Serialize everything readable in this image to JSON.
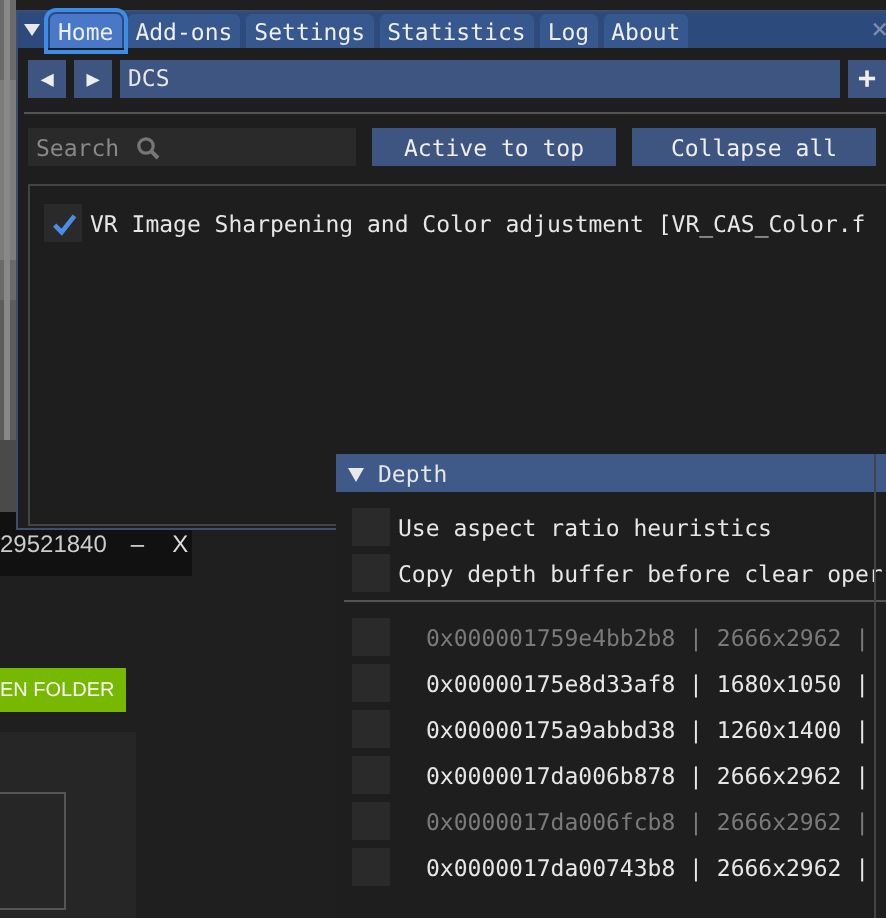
{
  "background_window": {
    "title": "29521840",
    "minimize": "–",
    "close": "X",
    "button": "EN FOLDER"
  },
  "main_window": {
    "tabs": [
      {
        "label": "Home",
        "selected": true
      },
      {
        "label": "Add-ons",
        "selected": false
      },
      {
        "label": "Settings",
        "selected": false
      },
      {
        "label": "Statistics",
        "selected": false
      },
      {
        "label": "Log",
        "selected": false
      },
      {
        "label": "About",
        "selected": false
      }
    ],
    "close": "×",
    "nav": {
      "back": "◀",
      "forward": "▶",
      "path": "DCS",
      "add": "+"
    },
    "search": {
      "placeholder": "Search"
    },
    "buttons": [
      "Active to top",
      "Collapse all"
    ],
    "effects": [
      {
        "label": "VR Image Sharpening and Color adjustment [VR_CAS_Color.f",
        "checked": true
      }
    ]
  },
  "depth_panel": {
    "header": "Depth",
    "expanded": true,
    "options": [
      {
        "label": "Use aspect ratio heuristics",
        "checked": false
      },
      {
        "label": "Copy depth buffer before clear oper",
        "checked": false
      }
    ],
    "buffers": [
      {
        "label": "0x000001759e4bb2b8 | 2666x2962 |",
        "checked": false,
        "disabled": true
      },
      {
        "label": "0x00000175e8d33af8 | 1680x1050 |",
        "checked": false,
        "disabled": false
      },
      {
        "label": "0x00000175a9abbd38 | 1260x1400 |",
        "checked": false,
        "disabled": false
      },
      {
        "label": "0x0000017da006b878 | 2666x2962 |",
        "checked": false,
        "disabled": false
      },
      {
        "label": "0x0000017da006fcb8 | 2666x2962 |",
        "checked": false,
        "disabled": true
      },
      {
        "label": "0x0000017da00743b8 | 2666x2962 |",
        "checked": false,
        "disabled": false
      }
    ]
  }
}
